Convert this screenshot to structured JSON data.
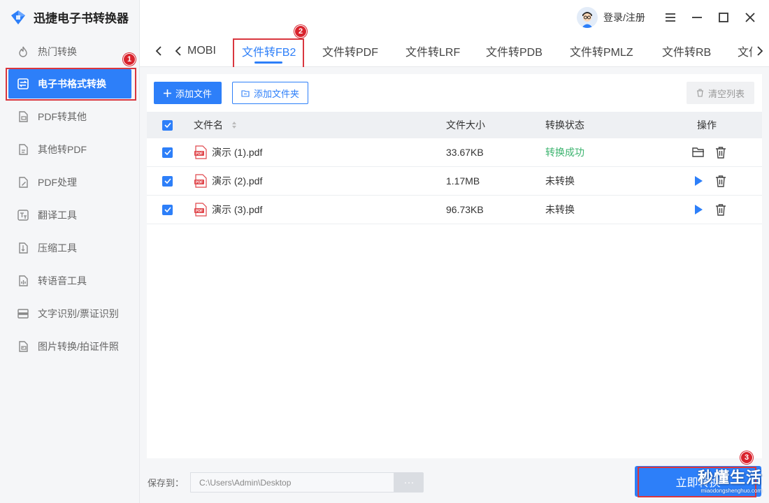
{
  "app": {
    "title": "迅捷电子书转换器"
  },
  "sidebar": {
    "items": [
      {
        "label": "热门转换",
        "icon": "hot-icon",
        "active": false
      },
      {
        "label": "电子书格式转换",
        "icon": "ebook-convert-icon",
        "active": true
      },
      {
        "label": "PDF转其他",
        "icon": "pdf-to-other-icon",
        "active": false
      },
      {
        "label": "其他转PDF",
        "icon": "other-to-pdf-icon",
        "active": false
      },
      {
        "label": "PDF处理",
        "icon": "pdf-edit-icon",
        "active": false
      },
      {
        "label": "翻译工具",
        "icon": "translate-icon",
        "active": false
      },
      {
        "label": "压缩工具",
        "icon": "compress-icon",
        "active": false
      },
      {
        "label": "转语音工具",
        "icon": "voice-icon",
        "active": false
      },
      {
        "label": "文字识别/票证识别",
        "icon": "ocr-icon",
        "active": false
      },
      {
        "label": "图片转换/拍证件照",
        "icon": "image-icon",
        "active": false
      }
    ]
  },
  "header": {
    "login_label": "登录/注册"
  },
  "tabs": {
    "items": [
      "MOBI",
      "文件转FB2",
      "文件转PDF",
      "文件转LRF",
      "文件转PDB",
      "文件转PMLZ",
      "文件转RB",
      "文件"
    ],
    "active_index": 1
  },
  "toolbar": {
    "add_file": "添加文件",
    "add_folder": "添加文件夹",
    "clear_list": "清空列表"
  },
  "table": {
    "headers": {
      "name": "文件名",
      "size": "文件大小",
      "status": "转换状态",
      "ops": "操作"
    },
    "rows": [
      {
        "name": "演示 (1).pdf",
        "size": "33.67KB",
        "status": "转换成功",
        "done": true
      },
      {
        "name": "演示 (2).pdf",
        "size": "1.17MB",
        "status": "未转换",
        "done": false
      },
      {
        "name": "演示 (3).pdf",
        "size": "96.73KB",
        "status": "未转换",
        "done": false
      }
    ]
  },
  "footer": {
    "save_label": "保存到：",
    "save_path": "C:\\Users\\Admin\\Desktop",
    "more_label": "···",
    "convert_label": "立即转换"
  },
  "annotations": {
    "badge1": "1",
    "badge2": "2",
    "badge3": "3"
  },
  "watermark": {
    "cn": "秒懂生活",
    "en": "miaodongshenghuo.com"
  },
  "colors": {
    "accent": "#2d7ff9",
    "success": "#3bb36e",
    "annotation": "#d9363e"
  }
}
